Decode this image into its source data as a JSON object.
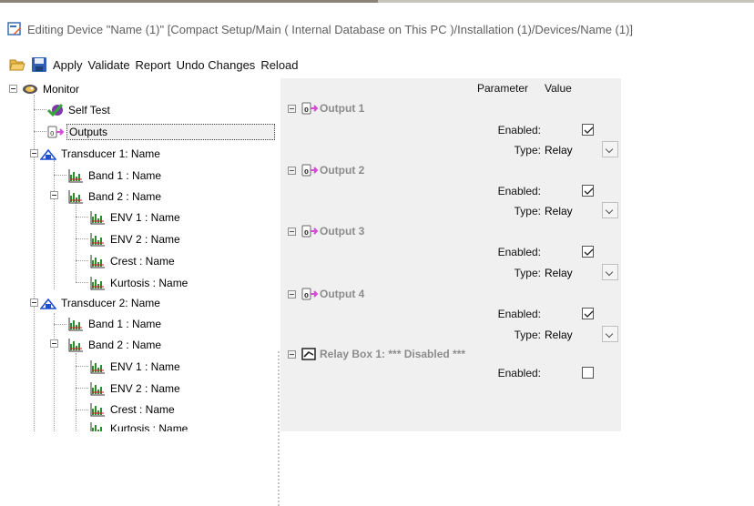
{
  "window": {
    "title": "Editing Device \"Name (1)\" [Compact Setup/Main ( Internal Database on This PC )/Installation (1)/Devices/Name (1)]",
    "title_icon": "edit-device-icon"
  },
  "toolbar": {
    "open_icon": "folder-open-icon",
    "save_icon": "save-icon",
    "apply": "Apply",
    "validate": "Validate",
    "report": "Report",
    "undo": "Undo Changes",
    "reload": "Reload"
  },
  "tree": {
    "monitor": "Monitor",
    "self_test": "Self Test",
    "outputs": "Outputs",
    "transducer1": {
      "label": "Transducer 1: Name",
      "band1": "Band 1 : Name",
      "band2": "Band 2 : Name",
      "env1": "ENV 1 : Name",
      "env2": "ENV 2 : Name",
      "crest": "Crest : Name",
      "kurtosis": "Kurtosis : Name"
    },
    "transducer2": {
      "label": "Transducer 2: Name",
      "band1": "Band 1 : Name",
      "band2": "Band 2 : Name",
      "env1": "ENV 1 : Name",
      "env2": "ENV 2 : Name",
      "crest": "Crest : Name",
      "kurtosis": "Kurtosis : Name"
    }
  },
  "grid": {
    "header_parameter": "Parameter",
    "header_value": "Value",
    "sections": [
      {
        "title": "Output 1",
        "enabled_label": "Enabled:",
        "enabled": true,
        "type_label": "Type:",
        "type_value": "Relay"
      },
      {
        "title": "Output 2",
        "enabled_label": "Enabled:",
        "enabled": true,
        "type_label": "Type:",
        "type_value": "Relay"
      },
      {
        "title": "Output 3",
        "enabled_label": "Enabled:",
        "enabled": true,
        "type_label": "Type:",
        "type_value": "Relay"
      },
      {
        "title": "Output 4",
        "enabled_label": "Enabled:",
        "enabled": true,
        "type_label": "Type:",
        "type_value": "Relay"
      },
      {
        "title": "Relay Box 1:  *** Disabled ***",
        "enabled_label": "Enabled:",
        "enabled": false
      }
    ]
  },
  "colors": {
    "selection_bg": "#f0f0f0",
    "grid_bg": "#f0f0f0",
    "section_text": "#8c8c8c",
    "transducer_icon": "#1f4fd1",
    "signal_icon": "#2e8b2e"
  }
}
